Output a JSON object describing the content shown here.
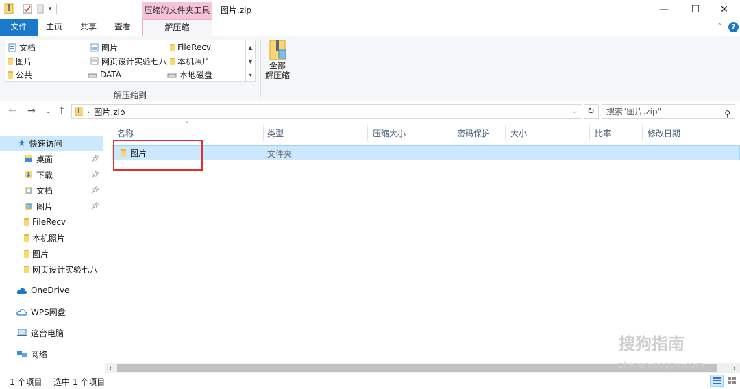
{
  "window": {
    "context_tab": "压缩的文件夹工具",
    "title": "图片.zip",
    "minimize": "—",
    "maximize": "☐",
    "close": "✕"
  },
  "tabs": {
    "file": "文件",
    "home": "主页",
    "share": "共享",
    "view": "查看",
    "extract": "解压缩",
    "help": "?"
  },
  "ribbon": {
    "gallery": [
      {
        "label": "文档",
        "icon": "document-folder-icon"
      },
      {
        "label": "图片",
        "icon": "folder-icon"
      },
      {
        "label": "FileRecv",
        "icon": "folder-icon"
      },
      {
        "label": "图片",
        "icon": "folder-icon"
      },
      {
        "label": "网页设计实验七八",
        "icon": "drive-icon"
      },
      {
        "label": "本机照片",
        "icon": "folder-icon"
      },
      {
        "label": "公共",
        "icon": "folder-icon"
      },
      {
        "label": "DATA",
        "icon": "drive-icon"
      },
      {
        "label": "本地磁盘",
        "icon": "drive-icon"
      }
    ],
    "group_label": "解压缩到",
    "extract_all_line1": "全部",
    "extract_all_line2": "解压缩"
  },
  "address": {
    "path": "图片.zip",
    "search_placeholder": "搜索\"图片.zip\""
  },
  "navpane": {
    "quick_access": "快速访问",
    "pinned": [
      {
        "label": "桌面"
      },
      {
        "label": "下载"
      },
      {
        "label": "文档"
      },
      {
        "label": "图片"
      }
    ],
    "recent": [
      {
        "label": "FileRecv"
      },
      {
        "label": "本机照片"
      },
      {
        "label": "图片"
      },
      {
        "label": "网页设计实验七八"
      }
    ],
    "onedrive": "OneDrive",
    "wps": "WPS网盘",
    "this_pc": "这台电脑",
    "network": "网络"
  },
  "columns": [
    "名称",
    "类型",
    "压缩大小",
    "密码保护",
    "大小",
    "比率",
    "修改日期"
  ],
  "rows": [
    {
      "name": "图片",
      "type": "文件夹"
    }
  ],
  "status": {
    "count": "1 个项目",
    "selected": "选中 1 个项目"
  },
  "watermark": {
    "brand": "搜狗指南",
    "url": "zhinan.sogou.com"
  },
  "colors": {
    "accent": "#1979ca",
    "context_tab": "#f6c3d9",
    "selection": "#cce8ff",
    "highlight_box": "#e03030"
  }
}
